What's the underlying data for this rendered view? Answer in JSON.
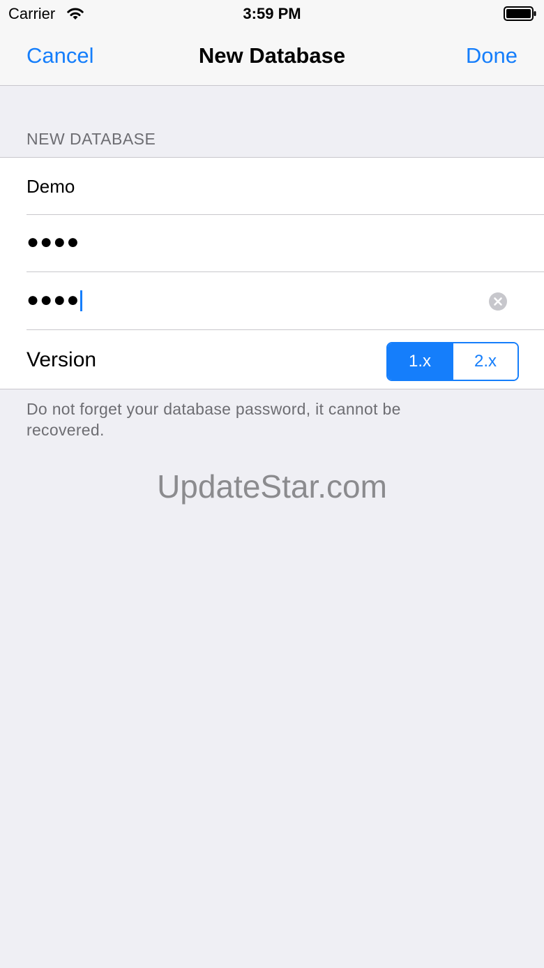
{
  "status_bar": {
    "carrier": "Carrier",
    "time": "3:59 PM",
    "icons": [
      "wifi-icon",
      "battery-icon"
    ]
  },
  "nav": {
    "cancel_label": "Cancel",
    "title": "New Database",
    "done_label": "Done"
  },
  "section": {
    "header": "NEW DATABASE",
    "name_value": "Demo",
    "password_value": "●●●●",
    "confirm_password_value": "●●●●",
    "version_label": "Version",
    "version_options": [
      "1.x",
      "2.x"
    ],
    "version_selected": "1.x",
    "footer": "Do not forget your database password, it cannot be recovered."
  },
  "watermark": "UpdateStar.com",
  "colors": {
    "accent": "#157efb",
    "background": "#efeff4",
    "secondary_text": "#6d6d72"
  }
}
